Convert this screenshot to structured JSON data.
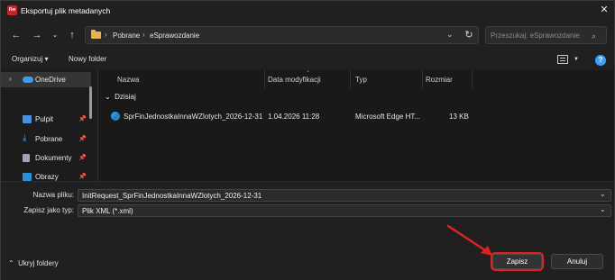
{
  "window": {
    "title": "Eksportuj plik metadanych",
    "app_icon_text": "Rw",
    "accent": "#d1202a"
  },
  "address": {
    "crumbs": [
      "Pobrane",
      "eSprawozdanie"
    ]
  },
  "search": {
    "placeholder": "Przeszukaj: eSprawozdanie"
  },
  "toolbar": {
    "organize": "Organizuj ▾",
    "new_folder": "Nowy folder"
  },
  "nav_pane": {
    "items": [
      {
        "label": "OneDrive",
        "icon": "cloud-icon"
      },
      {
        "label": "Pulpit",
        "icon": "desktop-icon"
      },
      {
        "label": "Pobrane",
        "icon": "download-icon"
      },
      {
        "label": "Dokumenty",
        "icon": "documents-icon"
      },
      {
        "label": "Obrazy",
        "icon": "pictures-icon"
      }
    ]
  },
  "columns": {
    "name": "Nazwa",
    "date": "Data modyfikacji",
    "type": "Typ",
    "size": "Rozmiar"
  },
  "group": {
    "label": "Dzisiaj"
  },
  "files": [
    {
      "name": "SprFinJednostkaInnaWZlotych_2026-12-31",
      "date": "1.04.2026 11:28",
      "type": "Microsoft Edge HT...",
      "size": "13 KB",
      "icon": "edge-icon"
    }
  ],
  "form": {
    "filename_label": "Nazwa pliku:",
    "filename_value": "InitRequest_SprFinJednostkaInnaWZlotych_2026-12-31",
    "filetype_label": "Zapisz jako typ:",
    "filetype_value": "Plik XML (*.xml)",
    "hide_folders": "Ukryj foldery",
    "save": "Zapisz",
    "cancel": "Anuluj"
  },
  "colors": {
    "highlight": "#e02020",
    "help": "#3aa0ff",
    "folder": "#e8b640"
  }
}
